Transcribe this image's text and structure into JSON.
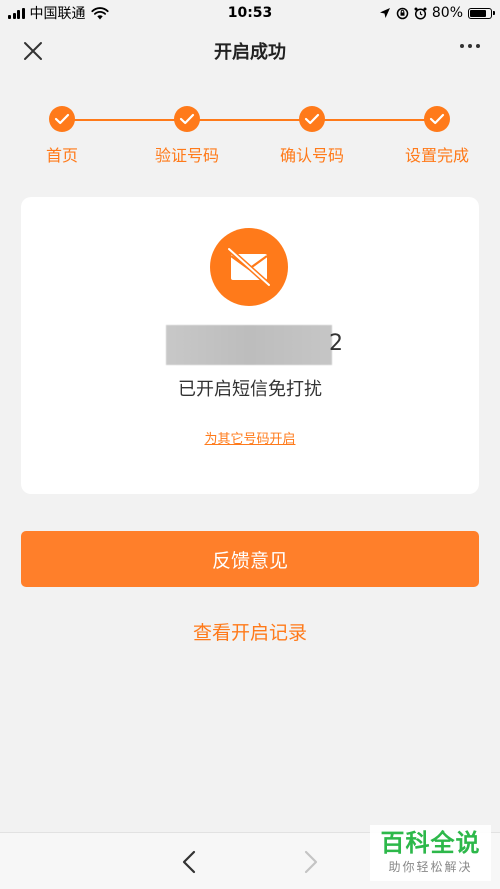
{
  "status_bar": {
    "carrier": "中国联通",
    "time": "10:53",
    "battery_percent": "80%",
    "battery_level": 0.8
  },
  "nav": {
    "title": "开启成功",
    "close_icon": "close-icon",
    "more_icon": "more-icon"
  },
  "steps": [
    {
      "label": "首页"
    },
    {
      "label": "验证号码"
    },
    {
      "label": "确认号码"
    },
    {
      "label": "设置完成"
    }
  ],
  "card": {
    "icon": "mail-blocked-icon",
    "masked_digit": "2",
    "status_text": "已开启短信免打扰",
    "other_number_link": "为其它号码开启"
  },
  "actions": {
    "feedback_label": "反馈意见",
    "record_link": "查看开启记录"
  },
  "watermark": {
    "main": "百科全说",
    "sub": "助你轻松解决"
  },
  "colors": {
    "accent": "#ff7a1a",
    "button": "#ff7f2a",
    "background": "#f2f2f2"
  }
}
